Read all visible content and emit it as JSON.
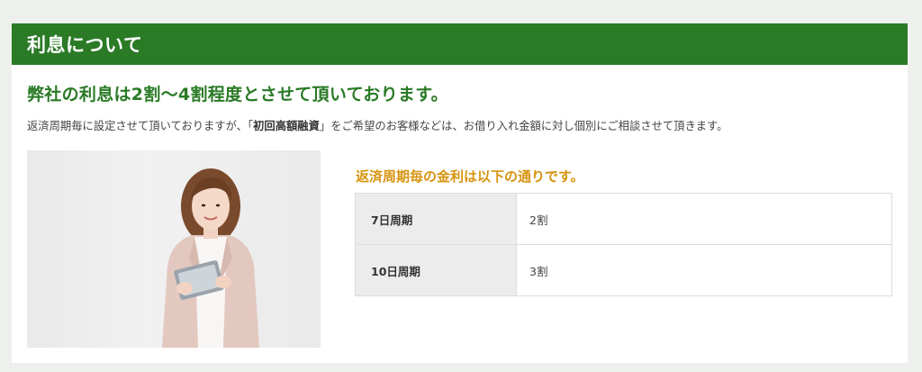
{
  "section": {
    "title": "利息について"
  },
  "headline": "弊社の利息は2割～4割程度とさせて頂いております。",
  "description": {
    "before": "返済周期毎に設定させて頂いておりますが、「",
    "bold": "初回高額融資",
    "after": "」をご希望のお客様などは、お借り入れ金額に対し個別にご相談させて頂きます。"
  },
  "rates": {
    "heading": "返済周期毎の金利は以下の通りです。",
    "rows": [
      {
        "period": "7日周期",
        "rate": "2割"
      },
      {
        "period": "10日周期",
        "rate": "3割"
      }
    ]
  },
  "colors": {
    "header_bg": "#2a7a26",
    "headline": "#2a7a26",
    "sub_heading": "#d6930e"
  }
}
